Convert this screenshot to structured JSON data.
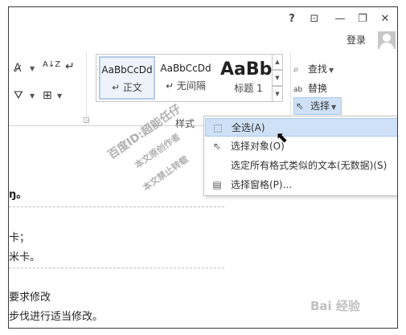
{
  "titlebar": {
    "help": "?",
    "ribbon_display": "⊡",
    "minimize": "—",
    "restore": "❐",
    "close": "✕"
  },
  "account": {
    "sign_in": "登录",
    "avatar_icon": "user-avatar-icon"
  },
  "ribbon": {
    "font_glyph": "A̷",
    "sort_glyph": "A↓Z",
    "paragraph_glyph": "↵",
    "shading_glyph": "⛛",
    "borders_glyph": "⊞",
    "styles": [
      {
        "sample": "AaBbCcDd",
        "name": "↵ 正文"
      },
      {
        "sample": "AaBbCcDd",
        "name": "↵ 无间隔"
      },
      {
        "sample": "AaBb",
        "name": "标题 1"
      }
    ],
    "styles_group_label": "样式",
    "editing": {
      "find": "查找",
      "replace": "替换",
      "select": "选择"
    }
  },
  "select_menu": {
    "items": [
      {
        "label": "全选(A)",
        "icon": "select-all-icon"
      },
      {
        "label": "选择对象(O)",
        "icon": "select-objects-icon"
      },
      {
        "label": "选定所有格式类似的文本(无数据)(S)",
        "icon": "select-similar-icon"
      },
      {
        "label": "选择窗格(P)...",
        "icon": "selection-pane-icon"
      }
    ]
  },
  "document": {
    "lines": [
      "ŋ。",
      "卡；",
      "米卡。",
      "要求修改",
      "步伐进行适当修改。"
    ]
  },
  "watermarks": {
    "line1": "百度ID:超能任仔",
    "line2": "本文原创作者",
    "line3": "本文禁止转载",
    "brand": "Bai 经验"
  }
}
